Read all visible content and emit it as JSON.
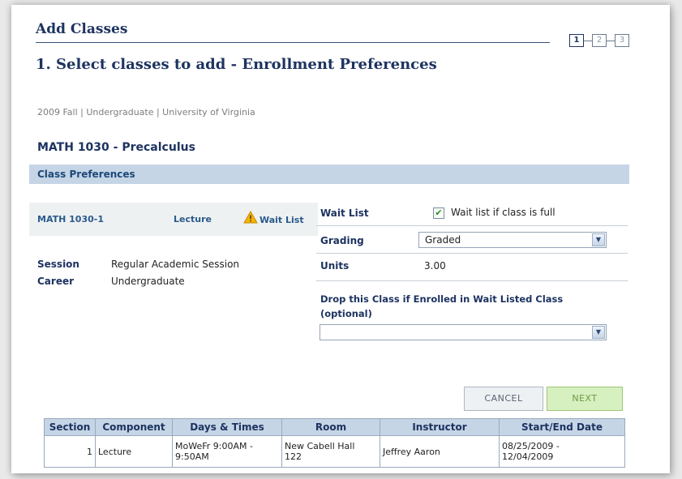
{
  "header": {
    "title": "Add Classes",
    "subtitle": "1. Select classes to add - Enrollment Preferences",
    "steps": [
      "1",
      "2",
      "3"
    ]
  },
  "term_line": "2009 Fall | Undergraduate | University of Virginia",
  "course_title": "MATH 1030 - Precalculus",
  "section_header": "Class Preferences",
  "section_summary": {
    "section_id": "MATH 1030-1",
    "component": "Lecture",
    "status_link": "Wait List"
  },
  "details": {
    "session_label": "Session",
    "session_value": "Regular Academic Session",
    "career_label": "Career",
    "career_value": "Undergraduate"
  },
  "preferences": {
    "wait_list_label": "Wait List",
    "wait_list_checkbox_label": "Wait list if class is full",
    "wait_list_checked": true,
    "grading_label": "Grading",
    "grading_value": "Graded",
    "units_label": "Units",
    "units_value": "3.00",
    "drop_label_line1": "Drop this Class if Enrolled in Wait Listed Class",
    "drop_label_line2": "(optional)",
    "drop_value": ""
  },
  "buttons": {
    "cancel": "CANCEL",
    "next": "NEXT"
  },
  "table": {
    "headers": [
      "Section",
      "Component",
      "Days & Times",
      "Room",
      "Instructor",
      "Start/End Date"
    ],
    "rows": [
      {
        "section": "1",
        "component": "Lecture",
        "days_times_1": "MoWeFr 9:00AM -",
        "days_times_2": "9:50AM",
        "room_1": "New Cabell Hall",
        "room_2": "122",
        "instructor": "Jeffrey Aaron",
        "dates_1": "08/25/2009 -",
        "dates_2": "12/04/2009"
      }
    ]
  },
  "colors": {
    "accent_navy": "#1d3360",
    "band_blue": "#c5d5e6",
    "warning_yellow": "#f5b400",
    "next_green": "#d7f0c0"
  },
  "icons": {
    "warning": "warning-triangle-icon",
    "check": "checkmark-icon",
    "dropdown": "chevron-down-icon"
  }
}
